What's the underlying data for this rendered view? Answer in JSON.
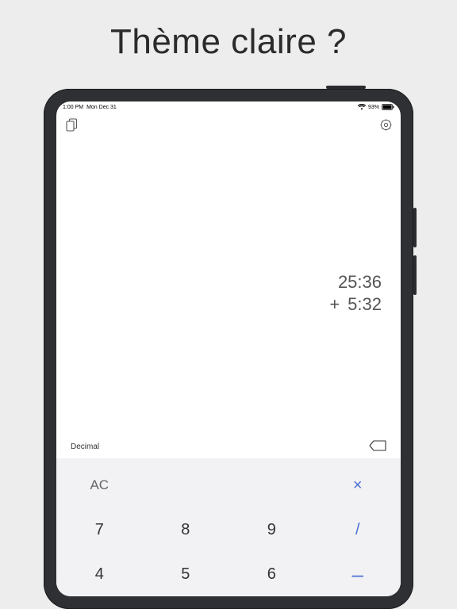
{
  "headline": "Thème claire ?",
  "statusbar": {
    "time": "1:00 PM",
    "date": "Mon Dec 31",
    "battery_pct": "93%"
  },
  "toolbar": {
    "left_icon": "copy-icon",
    "right_icon": "settings-icon"
  },
  "display": {
    "lines": [
      {
        "op": "",
        "value": "25:36"
      },
      {
        "op": "+",
        "value": "5:32"
      }
    ]
  },
  "mode": {
    "label": "Decimal"
  },
  "keypad": {
    "rows": [
      [
        {
          "label": "AC",
          "name": "key-ac",
          "cls": "dim"
        },
        {
          "label": "",
          "name": "key-empty",
          "cls": ""
        },
        {
          "label": "",
          "name": "key-empty2",
          "cls": ""
        },
        {
          "label": "×",
          "name": "key-multiply",
          "cls": "op-x"
        }
      ],
      [
        {
          "label": "7",
          "name": "key-7",
          "cls": ""
        },
        {
          "label": "8",
          "name": "key-8",
          "cls": ""
        },
        {
          "label": "9",
          "name": "key-9",
          "cls": ""
        },
        {
          "label": "/",
          "name": "key-divide",
          "cls": "op-div"
        }
      ],
      [
        {
          "label": "4",
          "name": "key-4",
          "cls": ""
        },
        {
          "label": "5",
          "name": "key-5",
          "cls": ""
        },
        {
          "label": "6",
          "name": "key-6",
          "cls": ""
        },
        {
          "label": "–",
          "name": "key-minus",
          "cls": "op-minus"
        }
      ]
    ]
  }
}
